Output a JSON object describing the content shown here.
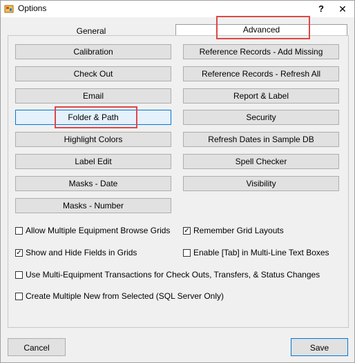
{
  "window": {
    "title": "Options",
    "help": "?",
    "close": "✕"
  },
  "tabs": {
    "general": "General",
    "advanced": "Advanced"
  },
  "buttons": {
    "calibration": "Calibration",
    "check_out": "Check Out",
    "email": "Email",
    "folder_path": "Folder & Path",
    "highlight_colors": "Highlight Colors",
    "label_edit": "Label Edit",
    "masks_date": "Masks - Date",
    "masks_number": "Masks - Number",
    "ref_add_missing": "Reference Records - Add Missing",
    "ref_refresh_all": "Reference Records - Refresh All",
    "report_label": "Report & Label",
    "security": "Security",
    "refresh_dates": "Refresh Dates in Sample DB",
    "spell_checker": "Spell Checker",
    "visibility": "Visibility"
  },
  "checkboxes": {
    "allow_multiple_grids": {
      "label": "Allow Multiple Equipment Browse Grids",
      "checked": ""
    },
    "remember_layouts": {
      "label": "Remember Grid Layouts",
      "checked": "✓"
    },
    "show_hide_fields": {
      "label": "Show and Hide Fields in Grids",
      "checked": "✓"
    },
    "enable_tab": {
      "label": "Enable [Tab] in Multi-Line Text Boxes",
      "checked": ""
    },
    "multi_equipment": {
      "label": "Use Multi-Equipment Transactions for Check Outs, Transfers, & Status Changes",
      "checked": ""
    },
    "create_multiple": {
      "label": "Create Multiple New from Selected (SQL Server Only)",
      "checked": ""
    }
  },
  "footer": {
    "cancel": "Cancel",
    "save": "Save"
  },
  "colors": {
    "highlight": "#e04646",
    "focus": "#0078d7"
  }
}
